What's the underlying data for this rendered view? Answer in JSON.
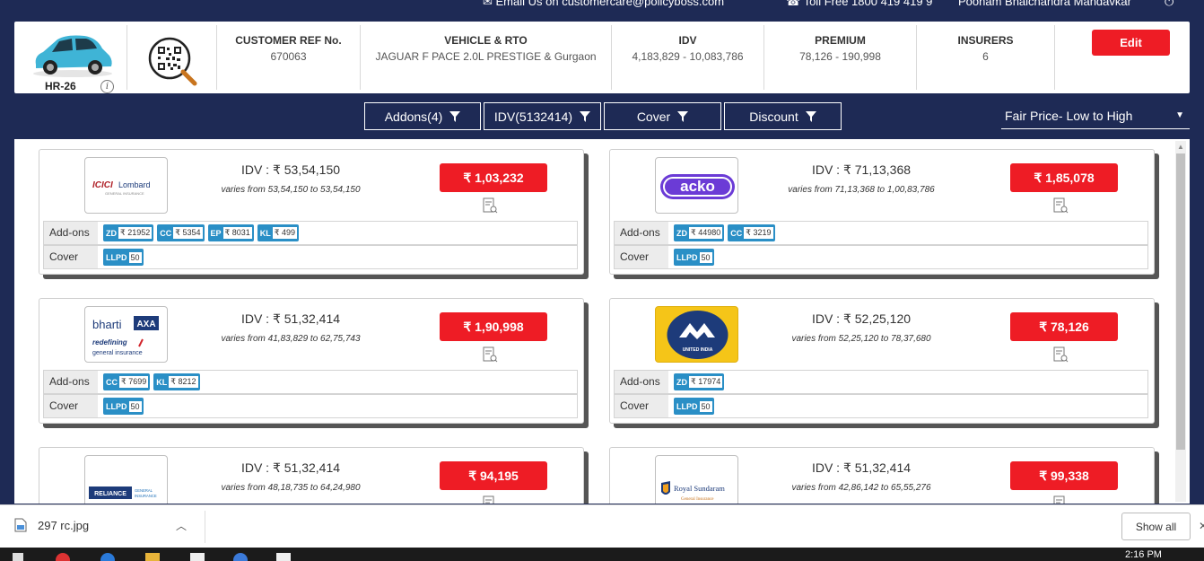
{
  "topbar": {
    "email": "Email Us on customercare@policyboss.com",
    "tollfree": "Toll Free 1800 419 419 9",
    "user": "Poonam Bhalchandra Mandavkar"
  },
  "header": {
    "reg": "HR-26",
    "cells": [
      {
        "title": "CUSTOMER REF No.",
        "value": "670063"
      },
      {
        "title": "VEHICLE & RTO",
        "value": "JAGUAR F PACE 2.0L PRESTIGE & Gurgaon"
      },
      {
        "title": "IDV",
        "value": "4,183,829 - 10,083,786"
      },
      {
        "title": "PREMIUM",
        "value": "78,126 - 190,998"
      },
      {
        "title": "INSURERS",
        "value": "6"
      }
    ],
    "edit_label": "Edit"
  },
  "filters": {
    "addons": "Addons(4)",
    "idv": "IDV(5132414)",
    "cover": "Cover",
    "discount": "Discount",
    "sort": "Fair Price- Low to High"
  },
  "row_labels": {
    "addons": "Add-ons",
    "cover": "Cover"
  },
  "quotes": [
    {
      "insurer": "ICICI Lombard",
      "logo_text": "ICICI Lombard",
      "logo_sub": "GENERAL INSURANCE",
      "idv": "IDV : ₹ 53,54,150",
      "varies": "varies from 53,54,150 to 53,54,150",
      "premium": "₹ 1,03,232",
      "addons": [
        {
          "code": "ZD",
          "value": "₹ 21952"
        },
        {
          "code": "CC",
          "value": "₹ 5354"
        },
        {
          "code": "EP",
          "value": "₹ 8031"
        },
        {
          "code": "KL",
          "value": "₹ 499"
        }
      ],
      "cover": [
        {
          "code": "LLPD",
          "value": "50"
        }
      ]
    },
    {
      "insurer": "ACKO",
      "logo_text": "acko",
      "idv": "IDV : ₹ 71,13,368",
      "varies": "varies from 71,13,368 to 1,00,83,786",
      "premium": "₹ 1,85,078",
      "addons": [
        {
          "code": "ZD",
          "value": "₹ 44980"
        },
        {
          "code": "CC",
          "value": "₹ 3219"
        }
      ],
      "cover": [
        {
          "code": "LLPD",
          "value": "50"
        }
      ]
    },
    {
      "insurer": "Bharti AXA",
      "logo_text": "bharti",
      "logo_axa": "AXA",
      "logo_tag1": "redefining",
      "logo_tag2": "general insurance",
      "idv": "IDV : ₹ 51,32,414",
      "varies": "varies from 41,83,829 to 62,75,743",
      "premium": "₹ 1,90,998",
      "addons": [
        {
          "code": "CC",
          "value": "₹ 7699"
        },
        {
          "code": "KL",
          "value": "₹ 8212"
        }
      ],
      "cover": [
        {
          "code": "LLPD",
          "value": "50"
        }
      ]
    },
    {
      "insurer": "United India",
      "logo_text": "UNITED INDIA",
      "idv": "IDV : ₹ 52,25,120",
      "varies": "varies from 52,25,120 to 78,37,680",
      "premium": "₹ 78,126",
      "addons": [
        {
          "code": "ZD",
          "value": "₹ 17974"
        }
      ],
      "cover": [
        {
          "code": "LLPD",
          "value": "50"
        }
      ]
    },
    {
      "insurer": "Reliance General Insurance",
      "logo_text": "RELIANCE",
      "logo_sub": "GENERAL INSURANCE",
      "idv": "IDV : ₹ 51,32,414",
      "varies": "varies from 48,18,735 to 64,24,980",
      "premium": "₹ 94,195",
      "addons": [],
      "cover": []
    },
    {
      "insurer": "Royal Sundaram",
      "logo_text": "Royal Sundaram",
      "logo_sub": "General Insurance",
      "idv": "IDV : ₹ 51,32,414",
      "varies": "varies from 42,86,142 to 65,55,276",
      "premium": "₹ 99,338",
      "addons": [],
      "cover": []
    }
  ],
  "downloads": {
    "file": "297 rc.jpg",
    "show_all": "Show all"
  },
  "taskbar": {
    "time": "2:16 PM"
  },
  "colors": {
    "navy": "#1e2a55",
    "red": "#ee1c25",
    "chip": "#2a8fc6"
  }
}
